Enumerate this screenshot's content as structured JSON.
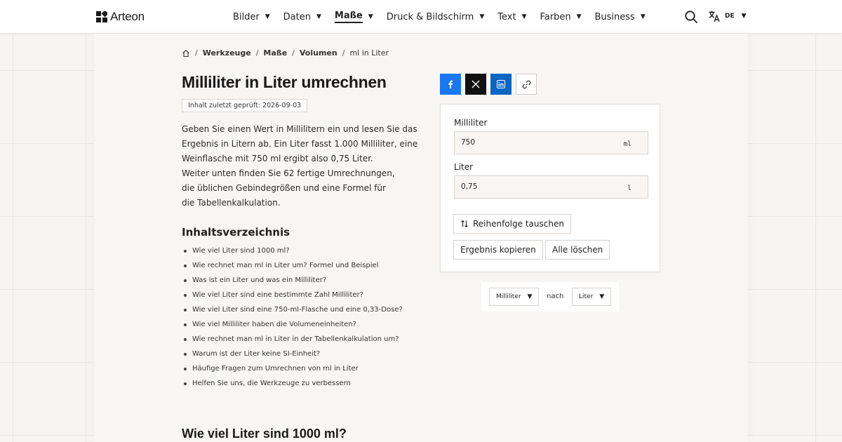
{
  "brand": {
    "name": "Arteon"
  },
  "nav": {
    "items": [
      {
        "label": "Bilder"
      },
      {
        "label": "Daten"
      },
      {
        "label": "Maße"
      },
      {
        "label": "Druck & Bildschirm"
      },
      {
        "label": "Text"
      },
      {
        "label": "Farben"
      },
      {
        "label": "Business"
      }
    ],
    "active": "Maße"
  },
  "language": {
    "code": "DE"
  },
  "breadcrumb": {
    "items": [
      "Werkzeuge",
      "Maße",
      "Volumen"
    ],
    "current": "ml in Liter"
  },
  "page": {
    "title": "Milliliter in Liter umrechnen",
    "review": "Inhalt zuletzt geprüft: 2026-09-03",
    "intro_lines": [
      "Geben Sie einen Wert in Millilitern ein und lesen Sie das",
      "Ergebnis in Litern ab. Ein Liter fasst 1.000 Milliliter, eine",
      "Weinflasche mit 750 ml ergibt also 0,75 Liter.",
      "Weiter unten finden Sie 62 fertige Umrechnungen,",
      "die üblichen Gebindegrößen und eine Formel für",
      "die Tabellenkalkulation."
    ]
  },
  "toc": {
    "title": "Inhaltsverzeichnis",
    "items": [
      "Wie viel Liter sind 1000 ml?",
      "Wie rechnet man ml in Liter um? Formel und Beispiel",
      "Was ist ein Liter und was ein Milliliter?",
      "Wie viel Liter sind eine bestimmte Zahl Milliliter?",
      "Wie viel Liter sind eine 750-ml-Flasche und eine 0,33-Dose?",
      "Wie viel Milliliter haben die Volumeneinheiten?",
      "Wie rechnet man ml in Liter in der Tabellenkalkulation um?",
      "Warum ist der Liter keine SI-Einheit?",
      "Häufige Fragen zum Umrechnen von ml in Liter",
      "Helfen Sie uns, die Werkzeuge zu verbessern"
    ]
  },
  "section": {
    "title": "Wie viel Liter sind 1000 ml?"
  },
  "share": {
    "colors": {
      "facebook": "#1877f2",
      "x": "#111111",
      "linkedin": "#0a66c2"
    }
  },
  "converter": {
    "from": {
      "label": "Milliliter",
      "value": "750",
      "unit": "ml"
    },
    "to": {
      "label": "Liter",
      "value": "0,75",
      "unit": "l"
    },
    "swap_label": "Reihenfolge tauschen",
    "copy_label": "Ergebnis kopieren",
    "clear_label": "Alle löschen"
  },
  "unit_selector": {
    "from": "Milliliter",
    "connector": "nach",
    "to": "Liter"
  }
}
